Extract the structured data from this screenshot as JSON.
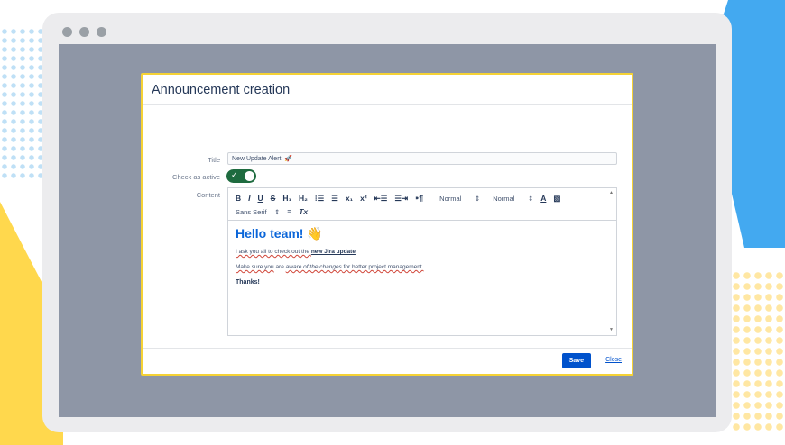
{
  "colors": {
    "accent_blue": "#0052cc",
    "toggle_green": "#1e6b3f",
    "modal_border": "#f5d235",
    "heading_blue": "#0b66d9"
  },
  "modal": {
    "title": "Announcement creation",
    "fields": {
      "title_label": "Title",
      "title_value": "New Update Alert! 🚀",
      "active_label": "Check as active",
      "active_state": "on",
      "content_label": "Content"
    },
    "toolbar": {
      "bold": "B",
      "italic": "I",
      "underline": "U",
      "strike": "S",
      "h1": "H₁",
      "h2": "H₂",
      "ordered_list": "⁝☰",
      "bullet_list": "☰",
      "subscript": "x₁",
      "superscript": "x²",
      "outdent": "⇤☰",
      "indent": "☰⇥",
      "direction": "⁍¶",
      "size_select": "Normal",
      "header_select": "Normal",
      "color": "A",
      "background": "▧",
      "font_select": "Sans Serif",
      "align": "≡",
      "clear": "Tx"
    },
    "content": {
      "heading": "Hello team! 👋",
      "p1_a": "I ask you all to check out the ",
      "p1_link": "new Jira update",
      "p2_a": "Make sure you",
      "p2_b": " are ",
      "p2_c": "aware of the changes",
      "p2_d": " for better project management.",
      "thanks": "Thanks!"
    },
    "footer": {
      "save": "Save",
      "close": "Close"
    }
  }
}
